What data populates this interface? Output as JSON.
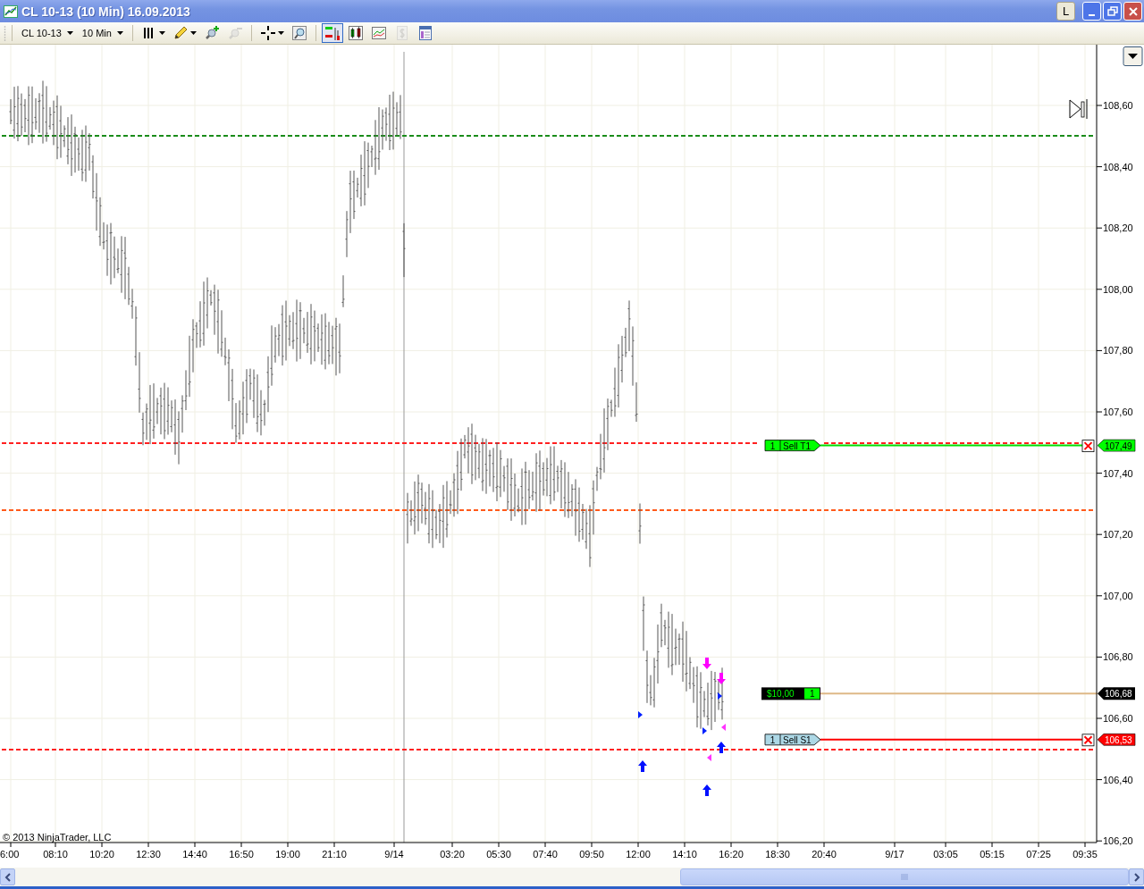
{
  "window": {
    "title": "CL 10-13 (10 Min)  16.09.2013",
    "layout_button": "L"
  },
  "toolbar": {
    "instrument": "CL 10-13",
    "interval": "10 Min",
    "tools": [
      {
        "kind": "bars",
        "dropdown": true,
        "selected": false,
        "disabled": false
      },
      {
        "kind": "pencil",
        "dropdown": true,
        "selected": false,
        "disabled": false
      },
      {
        "kind": "zoom-in",
        "dropdown": false,
        "selected": false,
        "disabled": false
      },
      {
        "kind": "zoom-out",
        "dropdown": false,
        "selected": false,
        "disabled": true
      },
      {
        "kind": "crosshair",
        "dropdown": true,
        "selected": false,
        "disabled": false
      },
      {
        "kind": "magnifier",
        "dropdown": false,
        "selected": false,
        "disabled": false
      },
      {
        "kind": "order-bars",
        "dropdown": false,
        "selected": true,
        "disabled": false
      },
      {
        "kind": "candles",
        "dropdown": false,
        "selected": false,
        "disabled": false
      },
      {
        "kind": "line-chart",
        "dropdown": false,
        "selected": false,
        "disabled": false
      },
      {
        "kind": "dollar",
        "dropdown": false,
        "selected": false,
        "disabled": true
      },
      {
        "kind": "data-box",
        "dropdown": false,
        "selected": false,
        "disabled": false
      }
    ]
  },
  "chart": {
    "y_labels": [
      "108,60",
      "108,40",
      "108,20",
      "108,00",
      "107,80",
      "107,60",
      "107,40",
      "107,20",
      "107,00",
      "106,80",
      "106,60",
      "106,40",
      "106,20"
    ],
    "x_labels": [
      "6:00",
      "08:10",
      "10:20",
      "12:30",
      "14:40",
      "16:50",
      "19:00",
      "21:10",
      "9/14",
      "03:20",
      "05:30",
      "07:40",
      "09:50",
      "12:00",
      "14:10",
      "16:20",
      "18:30",
      "20:40",
      "9/17",
      "03:05",
      "05:15",
      "07:25",
      "09:35"
    ],
    "price_lines": [
      {
        "color": "#1a8c1a"
      },
      {
        "color": "#ff2020"
      },
      {
        "color": "#ff5a1a"
      },
      {
        "color": "#ff2020"
      }
    ],
    "orders": [
      {
        "kind": "target",
        "quantity": "1",
        "label": "Sell T1",
        "price": "107,49"
      },
      {
        "kind": "stop",
        "quantity": "1",
        "label": "Sell S1",
        "price": "106,53"
      }
    ],
    "position": {
      "profit": "$10,00",
      "quantity": "1",
      "price": "106,68"
    },
    "copyright": "© 2013 NinjaTrader, LLC"
  }
}
